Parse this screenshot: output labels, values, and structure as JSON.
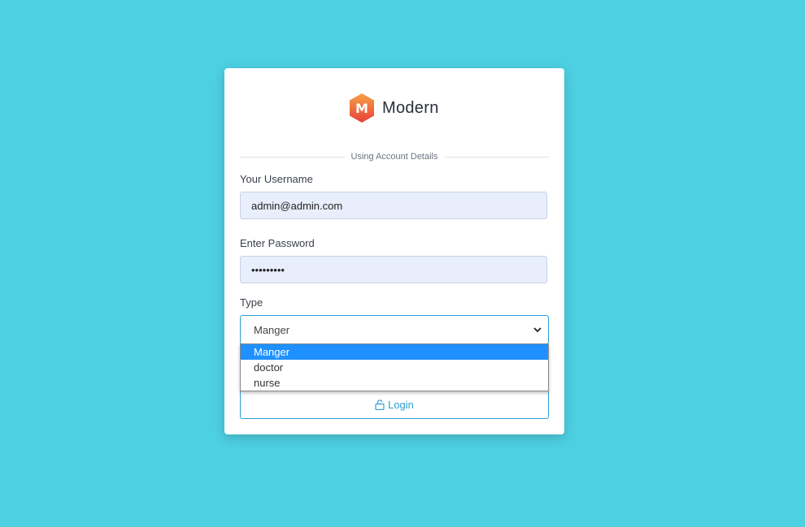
{
  "brand": {
    "name": "Modern",
    "logo_letter": "M",
    "logo_colors": [
      "#f7a046",
      "#e8403a"
    ]
  },
  "form": {
    "section_label": "Using Account Details",
    "username": {
      "label": "Your Username",
      "value": "admin@admin.com"
    },
    "password": {
      "label": "Enter Password",
      "value": "•••••••••"
    },
    "type": {
      "label": "Type",
      "selected": "Manger",
      "options": [
        "Manger",
        "doctor",
        "nurse"
      ]
    },
    "login_label": "Login"
  },
  "colors": {
    "background": "#4dd0e2",
    "accent": "#2d9fd6",
    "option_highlight": "#1e90ff"
  },
  "icons": {
    "logo": "hexagon-m-logo",
    "select": "chevron-down-icon",
    "login": "unlock-icon"
  }
}
